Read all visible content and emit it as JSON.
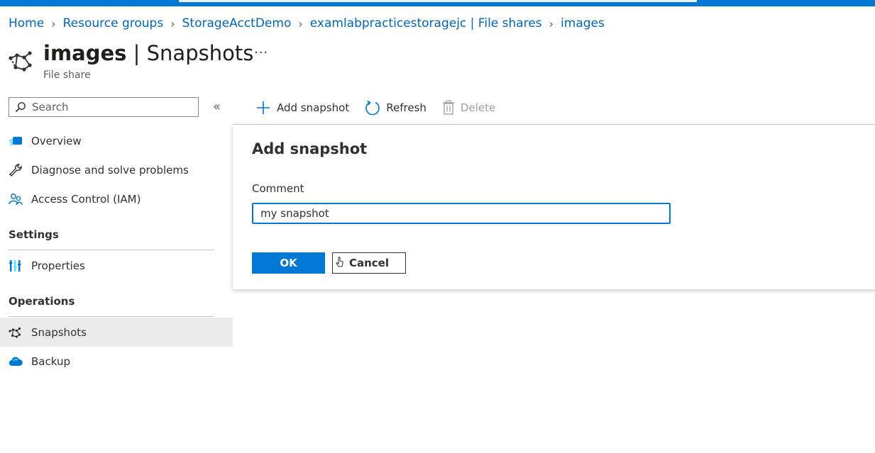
{
  "breadcrumb": [
    {
      "label": "Home"
    },
    {
      "label": "Resource groups"
    },
    {
      "label": "StorageAcctDemo"
    },
    {
      "label": "examlabpracticestoragejc | File shares"
    },
    {
      "label": "images"
    }
  ],
  "header": {
    "title_resource": "images",
    "title_separator": " | ",
    "title_page": "Snapshots",
    "subtitle": "File share",
    "more_label": "···",
    "icon": "snapshots-icon"
  },
  "sidebar": {
    "search_placeholder": "Search",
    "collapse_label": "«",
    "items": [
      {
        "label": "Overview",
        "icon": "overview-icon"
      },
      {
        "label": "Diagnose and solve problems",
        "icon": "wrench-icon"
      },
      {
        "label": "Access Control (IAM)",
        "icon": "people-icon"
      }
    ],
    "sections": [
      {
        "title": "Settings",
        "items": [
          {
            "label": "Properties",
            "icon": "properties-icon"
          }
        ]
      },
      {
        "title": "Operations",
        "items": [
          {
            "label": "Snapshots",
            "icon": "snapshots-icon",
            "selected": true
          },
          {
            "label": "Backup",
            "icon": "backup-cloud-icon"
          }
        ]
      }
    ]
  },
  "toolbar": {
    "add_label": "Add snapshot",
    "refresh_label": "Refresh",
    "delete_label": "Delete"
  },
  "dialog": {
    "title": "Add snapshot",
    "comment_label": "Comment",
    "comment_value": "my snapshot",
    "ok_label": "OK",
    "cancel_label": "Cancel"
  },
  "colors": {
    "accent": "#0078d4",
    "link": "#0067b8",
    "selected_bg": "#ebebeb"
  }
}
